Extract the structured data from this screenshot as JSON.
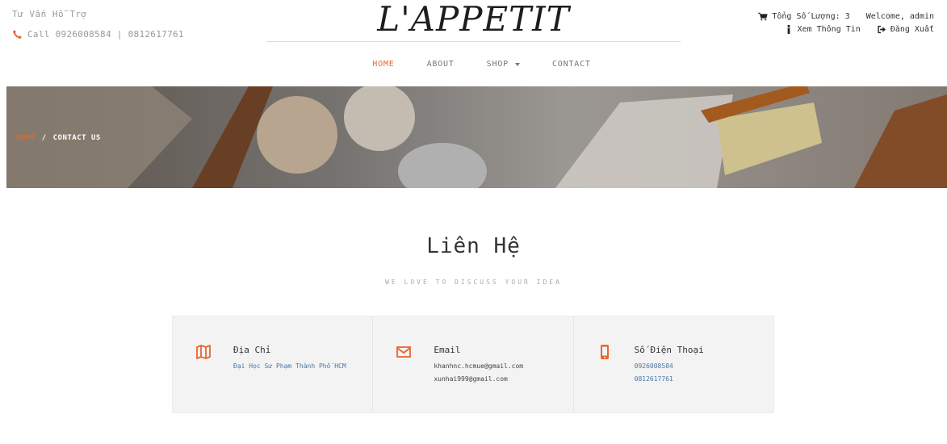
{
  "header": {
    "support_title": "Tư Vấn Hỗ Trợ",
    "support_phone": "Call 0926008584 | 0812617761",
    "logo": "L'APPETIT",
    "cart_label": "Tổng Số Lượng: 3",
    "welcome": "Welcome, admin",
    "profile_label": "Xem Thông Tin",
    "logout_label": "Đăng Xuất"
  },
  "nav": {
    "items": [
      "HOME",
      "ABOUT",
      "SHOP",
      "CONTACT"
    ],
    "active": "HOME"
  },
  "banner": {
    "breadcrumb_home": "HOME",
    "breadcrumb_sep": "/",
    "breadcrumb_current": "CONTACT US"
  },
  "contact": {
    "title": "Liên Hệ",
    "subtitle": "WE LOVE TO DISCUSS YOUR IDEA",
    "address": {
      "label": "Địa Chỉ",
      "value": "Đại Học Sư Phạm Thành Phố HCM",
      "icon": "map-icon"
    },
    "email": {
      "label": "Email",
      "values": [
        "khanhnc.hcmue@gmail.com",
        "xunhai999@gmail.com"
      ],
      "icon": "envelope-icon"
    },
    "phone": {
      "label": "Số Điện Thoại",
      "values": [
        "0926008584",
        "0812617761"
      ],
      "icon": "mobile-icon"
    }
  },
  "colors": {
    "accent": "#e8652f",
    "link": "#4a76a8",
    "card_bg": "#f3f3f3"
  }
}
